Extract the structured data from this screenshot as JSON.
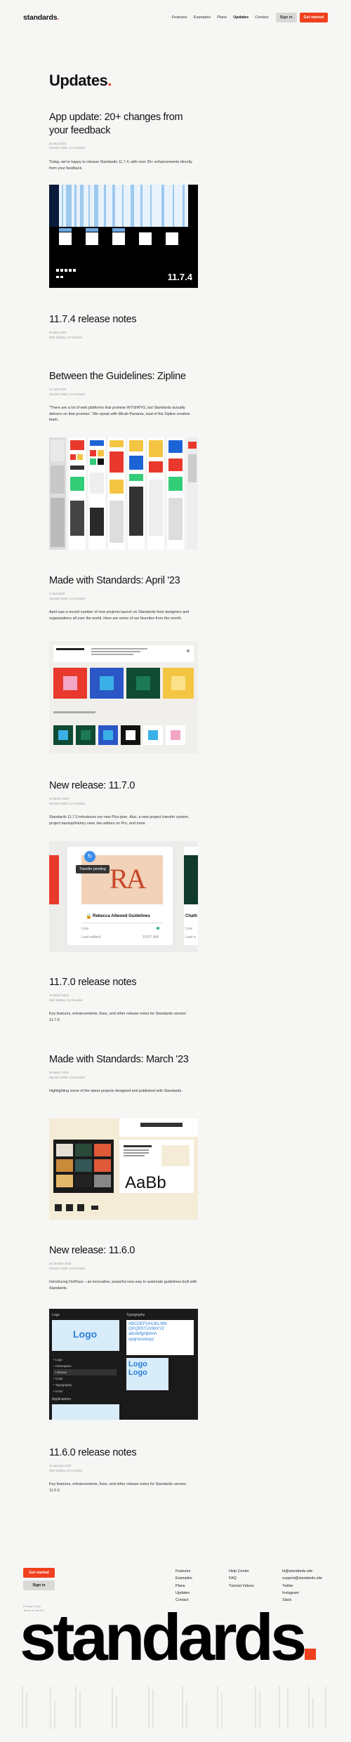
{
  "nav": {
    "logo": "standards",
    "links": [
      "Features",
      "Examples",
      "Plans",
      "Updates",
      "Contact"
    ],
    "active": "Updates",
    "sign_in": "Sign in",
    "get_started": "Get started"
  },
  "page": {
    "title": "Updates"
  },
  "posts": [
    {
      "title": "App update: 20+ changes from your feedback",
      "date": "25 May 2023",
      "author": "Hannah Smith, Co-Founder",
      "excerpt": "Today, we're happy to release Standards 11.7.4, with over 20+ enhancements directly from your feedback.",
      "image_label": "11.7.4"
    },
    {
      "title": "11.7.4 release notes",
      "date": "25 May 2023",
      "author": "Web Writing, Co-Founder",
      "excerpt": ""
    },
    {
      "title": "Between the Guidelines: Zipline",
      "date": "22 April 2023",
      "author": "Hannah Smith, Co-Founder",
      "excerpt": "\"There are a lot of web platforms that promise WYSIWYG, but Standards actually delivers on that promise.\" We speak with Micah Panama, lead of the Zipline creative team."
    },
    {
      "title": "Made with Standards: April '23",
      "date": "3 April 2023",
      "author": "Hannah Smith, Co-Founder",
      "excerpt": "April saw a record number of new projects launch on Standards from designers and organisations all over the world. Here are some of our favorites from the month."
    },
    {
      "title": "New release: 11.7.0",
      "date": "15 March 2023",
      "author": "Hannah Smith, Co-Founder",
      "excerpt": "Standards 11.7.0 introduces our new Plus plan. Also, a new project transfer system, project backup/history view, two editors on Pro, and more.",
      "card": {
        "pending": "Transfer pending",
        "name": "Rebecca Allwood Guidelines",
        "status": "Live",
        "edited_label": "Last edited",
        "edited_time": "10:07 AM",
        "peek_name": "Chath",
        "peek_status": "Live",
        "peek_edited": "Last e"
      }
    },
    {
      "title": "11.7.0 release notes",
      "date": "15 March 2023",
      "author": "Web Writing, Co-Founder",
      "excerpt": "Key features, enhancements, fixes, and other release notes for Standards version 11.7.0."
    },
    {
      "title": "Made with Standards: March '23",
      "date": "28 March 2023",
      "author": "Hannah Smith, Co-Founder",
      "excerpt": "Highlighting some of the latest projects designed and published with Standards.",
      "specimen": "AaBb"
    },
    {
      "title": "New release: 11.6.0",
      "date": "25 January 2023",
      "author": "Hannah Smith, Co-Founder",
      "excerpt": "Introducing DotPass – an innovative, powerful new way to automate guidelines built with Standards.",
      "panel": {
        "logo_head": "Logo",
        "typo_head": "Typography",
        "logo_text": "Logo",
        "apps": "Applications",
        "abc1": "ABCDEFGHIJKLMN",
        "abc2": "OPQRSTUVWXYZ",
        "abc3": "abcdefghijklmn",
        "abc4": "opqrstuvwxyz"
      }
    },
    {
      "title": "11.6.0 release notes",
      "date": "25 January 2023",
      "author": "Web Writing, Co-Founder",
      "excerpt": "Key features, enhancements, fixes, and other release notes for Standards version 11.6.0."
    }
  ],
  "footer": {
    "get_started": "Get started",
    "sign_in": "Sign in",
    "legal": [
      "Privacy Policy",
      "Terms of Service"
    ],
    "col1": [
      "Features",
      "Examples",
      "Plans",
      "Updates",
      "Contact"
    ],
    "col2": [
      "Help Center",
      "FAQ",
      "Tutorial Videos"
    ],
    "col3": [
      "hi@standards.site",
      "support@standards.site",
      "Twitter",
      "Instagram",
      "Slack"
    ],
    "wordmark": "standards"
  },
  "colors": {
    "accent": "#f0401d",
    "bg": "#f6f6f4"
  }
}
